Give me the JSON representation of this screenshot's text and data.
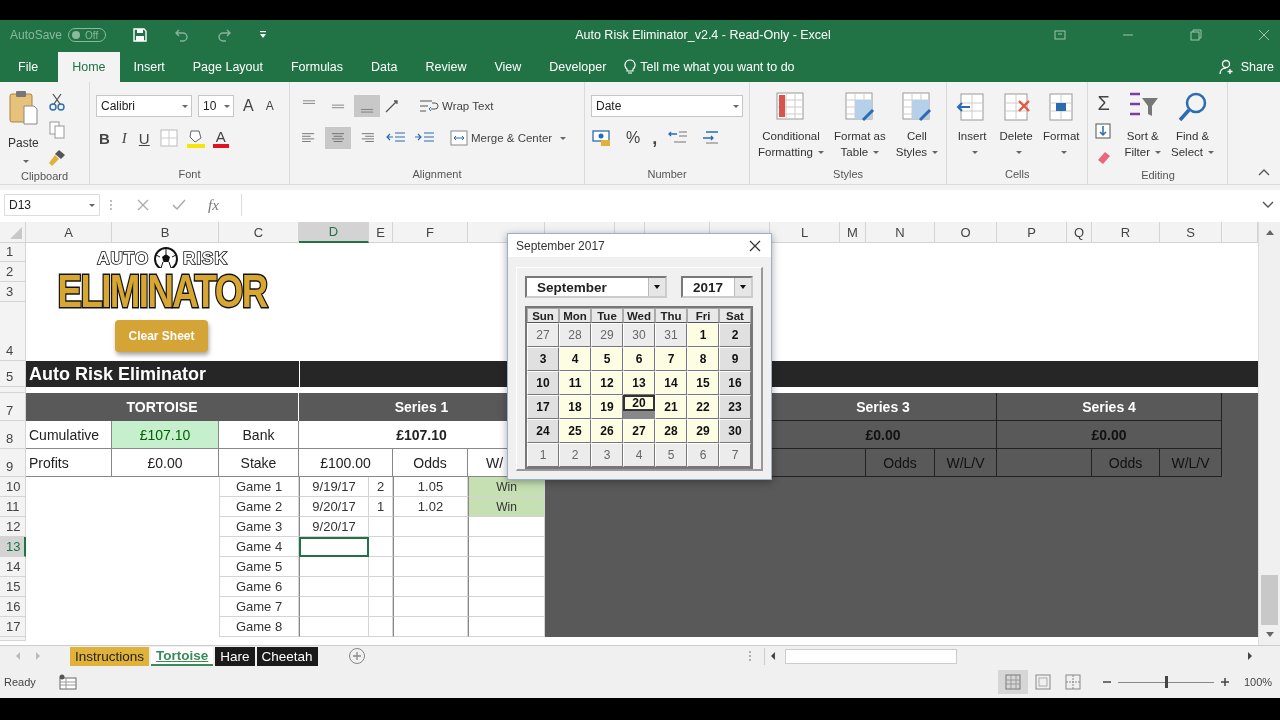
{
  "title_bar": {
    "autosave": {
      "label": "AutoSave",
      "state_text": "Off",
      "on": false
    },
    "title": "Auto Risk Eliminator_v2.4  -  Read-Only  -  Excel"
  },
  "ribbon_tabs": [
    {
      "label": "File",
      "selected": false
    },
    {
      "label": "Home",
      "selected": true
    },
    {
      "label": "Insert",
      "selected": false
    },
    {
      "label": "Page Layout",
      "selected": false
    },
    {
      "label": "Formulas",
      "selected": false
    },
    {
      "label": "Data",
      "selected": false
    },
    {
      "label": "Review",
      "selected": false
    },
    {
      "label": "View",
      "selected": false
    },
    {
      "label": "Developer",
      "selected": false
    }
  ],
  "tell_me": "Tell me what you want to do",
  "share": "Share",
  "ribbon": {
    "clipboard": {
      "paste": "Paste",
      "group": "Clipboard"
    },
    "font": {
      "name": "Calibri",
      "size": "10",
      "grow": "A",
      "shrink": "A",
      "bold": "B",
      "italic": "I",
      "underline": "U",
      "font_color": "A",
      "group": "Font"
    },
    "alignment": {
      "vertical_align": [
        {
          "selected": false
        },
        {
          "selected": false
        },
        {
          "selected": true
        }
      ],
      "horizontal_align": [
        {
          "selected": false
        },
        {
          "selected": true
        },
        {
          "selected": false
        }
      ],
      "wrap": "Wrap Text",
      "merge": "Merge & Center",
      "group": "Alignment"
    },
    "number": {
      "format": "Date",
      "percent": "%",
      "comma": ",",
      "group": "Number"
    },
    "styles": {
      "buttons": [
        [
          "Conditional",
          "Formatting"
        ],
        [
          "Format as",
          "Table"
        ],
        [
          "Cell",
          "Styles"
        ]
      ],
      "group": "Styles"
    },
    "cells": {
      "buttons": [
        "Insert",
        "Delete",
        "Format"
      ],
      "group": "Cells"
    },
    "editing": {
      "sum": "Σ",
      "buttons": [
        [
          "Sort &",
          "Filter"
        ],
        [
          "Find &",
          "Select"
        ]
      ],
      "group": "Editing"
    }
  },
  "formula_bar": {
    "name_box": "D13",
    "fx": "fx"
  },
  "column_headers": [
    {
      "label": "A",
      "selected": false
    },
    {
      "label": "B",
      "selected": false
    },
    {
      "label": "C",
      "selected": false
    },
    {
      "label": "D",
      "selected": true
    },
    {
      "label": "E",
      "selected": false
    },
    {
      "label": "F",
      "selected": false
    },
    {
      "label": "L",
      "selected": false
    },
    {
      "label": "M",
      "selected": false
    },
    {
      "label": "N",
      "selected": false
    },
    {
      "label": "O",
      "selected": false
    },
    {
      "label": "P",
      "selected": false
    },
    {
      "label": "Q",
      "selected": false
    },
    {
      "label": "R",
      "selected": false
    },
    {
      "label": "S",
      "selected": false
    }
  ],
  "row_headers": [
    {
      "label": "1",
      "selected": false
    },
    {
      "label": "2",
      "selected": false
    },
    {
      "label": "3",
      "selected": false
    },
    {
      "label": "4",
      "selected": false
    },
    {
      "label": "5",
      "selected": false
    },
    {
      "label": "7",
      "selected": false
    },
    {
      "label": "8",
      "selected": false
    },
    {
      "label": "9",
      "selected": false
    },
    {
      "label": "10",
      "selected": false
    },
    {
      "label": "11",
      "selected": false
    },
    {
      "label": "12",
      "selected": false
    },
    {
      "label": "13",
      "selected": true
    },
    {
      "label": "14",
      "selected": false
    },
    {
      "label": "15",
      "selected": false
    },
    {
      "label": "16",
      "selected": false
    },
    {
      "label": "17",
      "selected": false
    }
  ],
  "logo": {
    "top_left": "AUTO",
    "top_right": "RISK",
    "main": "ELIMINATOR"
  },
  "clear_button": "Clear Sheet",
  "banner": "Auto Risk Eliminator",
  "summary": {
    "heading": "TORTOISE",
    "cumulative_label": "Cumulative",
    "cumulative": "£107.10",
    "profits_label": "Profits",
    "profits": "£0.00",
    "bank_label": "Bank",
    "stake_label": "Stake"
  },
  "series": [
    {
      "title": "Series 1",
      "bank": "£107.10",
      "stake": "£100.00",
      "odds_label": "Odds",
      "result_label": "W/"
    },
    {
      "title": "Series 3",
      "bank": "£0.00",
      "odds_label": "Odds",
      "result_label": "W/L/V"
    },
    {
      "title": "Series 4",
      "bank": "£0.00",
      "odds_label": "Odds",
      "result_label": "W/L/V"
    }
  ],
  "games": [
    {
      "label": "Game 1",
      "date": "9/19/17",
      "number": "2",
      "odds": "1.05",
      "result": "Win",
      "won": true,
      "selected": false
    },
    {
      "label": "Game 2",
      "date": "9/20/17",
      "number": "1",
      "odds": "1.02",
      "result": "Win",
      "won": true,
      "selected": false
    },
    {
      "label": "Game 3",
      "date": "9/20/17",
      "selected": false
    },
    {
      "label": "Game 4",
      "selected": true
    },
    {
      "label": "Game 5",
      "selected": false
    },
    {
      "label": "Game 6",
      "selected": false
    },
    {
      "label": "Game 7",
      "selected": false
    },
    {
      "label": "Game 8",
      "selected": false
    }
  ],
  "date_picker": {
    "title": "September 2017",
    "month": "September",
    "year": "2017",
    "weekdays": [
      "Sun",
      "Mon",
      "Tue",
      "Wed",
      "Thu",
      "Fri",
      "Sat"
    ],
    "days": [
      {
        "label": "27",
        "kind": "outside",
        "selected": false
      },
      {
        "label": "28",
        "kind": "outside",
        "selected": false
      },
      {
        "label": "29",
        "kind": "outside",
        "selected": false
      },
      {
        "label": "30",
        "kind": "outside",
        "selected": false
      },
      {
        "label": "31",
        "kind": "outside",
        "selected": false
      },
      {
        "label": "1",
        "kind": "weekday",
        "selected": false
      },
      {
        "label": "2",
        "kind": "weekend",
        "selected": false
      },
      {
        "label": "3",
        "kind": "weekend",
        "selected": false
      },
      {
        "label": "4",
        "kind": "weekday",
        "selected": false
      },
      {
        "label": "5",
        "kind": "weekday",
        "selected": false
      },
      {
        "label": "6",
        "kind": "weekday",
        "selected": false
      },
      {
        "label": "7",
        "kind": "weekday",
        "selected": false
      },
      {
        "label": "8",
        "kind": "weekday",
        "selected": false
      },
      {
        "label": "9",
        "kind": "weekend",
        "selected": false
      },
      {
        "label": "10",
        "kind": "weekend",
        "selected": false
      },
      {
        "label": "11",
        "kind": "weekday",
        "selected": false
      },
      {
        "label": "12",
        "kind": "weekday",
        "selected": false
      },
      {
        "label": "13",
        "kind": "weekday",
        "selected": false
      },
      {
        "label": "14",
        "kind": "weekday",
        "selected": false
      },
      {
        "label": "15",
        "kind": "weekday",
        "selected": false
      },
      {
        "label": "16",
        "kind": "weekend",
        "selected": false
      },
      {
        "label": "17",
        "kind": "weekend",
        "selected": false
      },
      {
        "label": "18",
        "kind": "weekday",
        "selected": false
      },
      {
        "label": "19",
        "kind": "weekday",
        "selected": false
      },
      {
        "label": "20",
        "kind": "weekday",
        "selected": true
      },
      {
        "label": "21",
        "kind": "weekday",
        "selected": false
      },
      {
        "label": "22",
        "kind": "weekday",
        "selected": false
      },
      {
        "label": "23",
        "kind": "weekend",
        "selected": false
      },
      {
        "label": "24",
        "kind": "weekend",
        "selected": false
      },
      {
        "label": "25",
        "kind": "weekday",
        "selected": false
      },
      {
        "label": "26",
        "kind": "weekday",
        "selected": false
      },
      {
        "label": "27",
        "kind": "weekday",
        "selected": false
      },
      {
        "label": "28",
        "kind": "weekday",
        "selected": false
      },
      {
        "label": "29",
        "kind": "weekday",
        "selected": false
      },
      {
        "label": "30",
        "kind": "weekend",
        "selected": false
      },
      {
        "label": "1",
        "kind": "outside",
        "selected": false
      },
      {
        "label": "2",
        "kind": "outside",
        "selected": false
      },
      {
        "label": "3",
        "kind": "outside",
        "selected": false
      },
      {
        "label": "4",
        "kind": "outside",
        "selected": false
      },
      {
        "label": "5",
        "kind": "outside",
        "selected": false
      },
      {
        "label": "6",
        "kind": "outside",
        "selected": false
      },
      {
        "label": "7",
        "kind": "outside",
        "selected": false
      }
    ]
  },
  "sheet_tabs": [
    {
      "label": "Instructions",
      "color": "#e0b23a",
      "selected": false
    },
    {
      "label": "Tortoise",
      "color": "#3a8a5a",
      "selected": true
    },
    {
      "label": "Hare",
      "color": "#1a1a1a",
      "selected": false
    },
    {
      "label": "Cheetah",
      "color": "#1a1a1a",
      "selected": false
    }
  ],
  "status_bar": {
    "ready": "Ready",
    "zoom": {
      "level": 0.5,
      "reading": "100%"
    }
  }
}
